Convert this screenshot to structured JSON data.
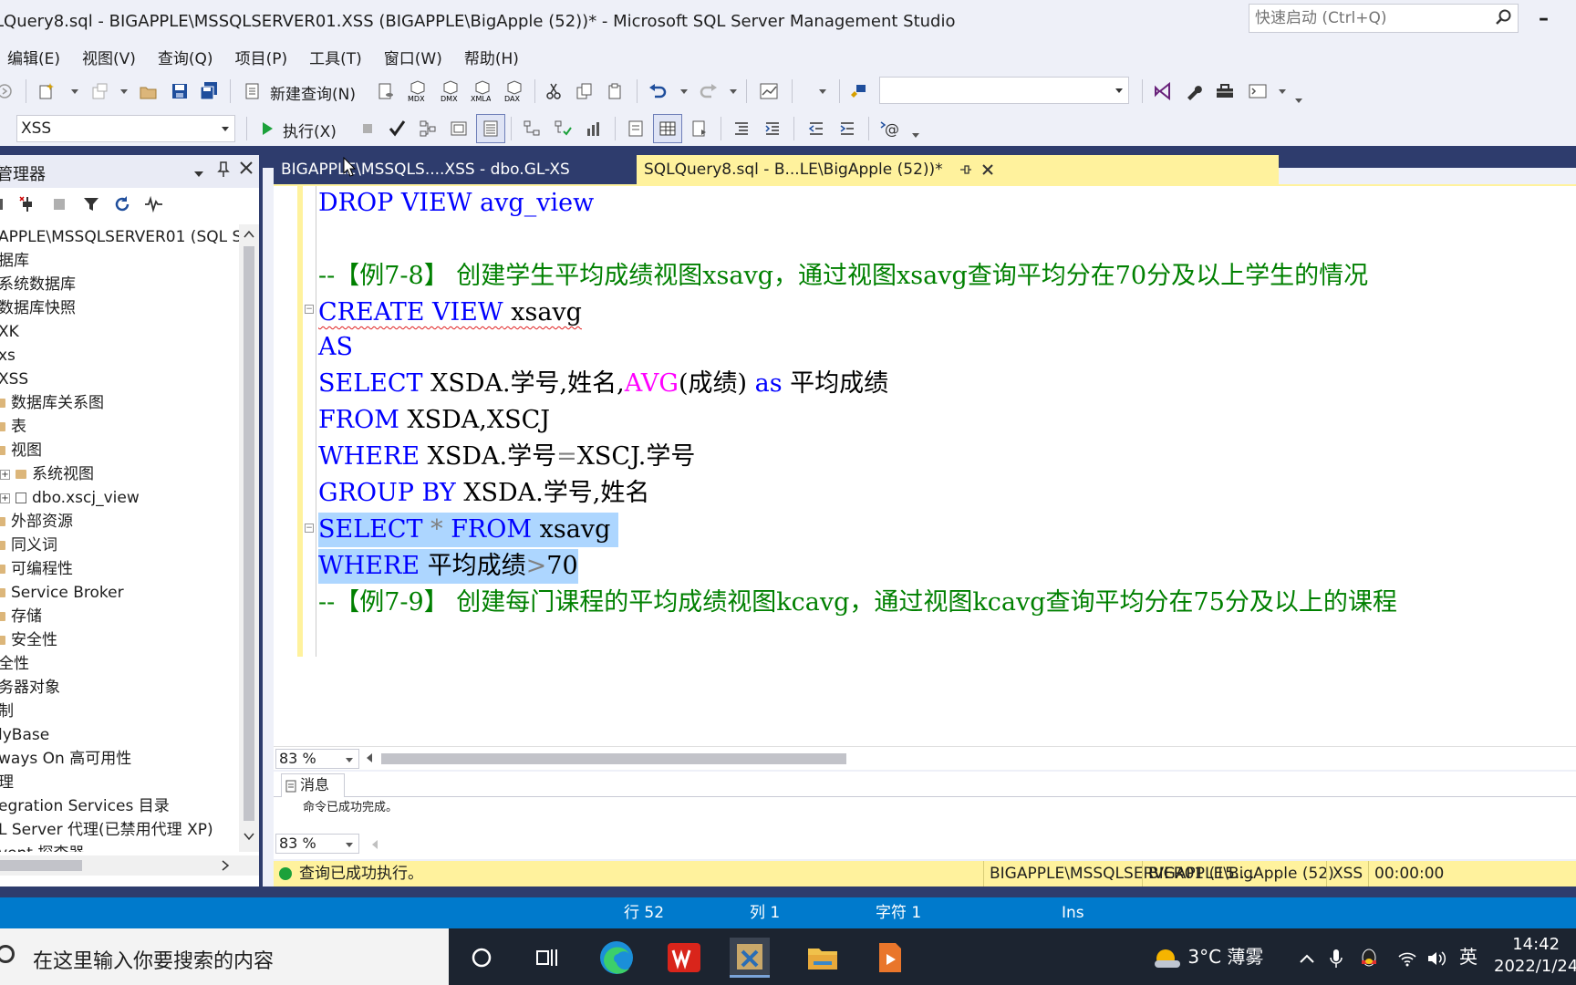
{
  "window": {
    "title": "LQuery8.sql - BIGAPPLE\\MSSQLSERVER01.XSS (BIGAPPLE\\BigApple (52))* - Microsoft SQL Server Management Studio",
    "quick_launch_placeholder": "快速启动 (Ctrl+Q)"
  },
  "menu": [
    "编辑(E)",
    "视图(V)",
    "查询(Q)",
    "项目(P)",
    "工具(T)",
    "窗口(W)",
    "帮助(H)"
  ],
  "toolbar": {
    "new_query": "新建查询(N)",
    "execute": "执行(X)",
    "database": "XSS",
    "mini_icons": [
      "MDX",
      "DMX",
      "XMLA",
      "DAX"
    ]
  },
  "object_explorer": {
    "title": "管理器",
    "server": "APPLE\\MSSQLSERVER01 (SQL Se",
    "items": [
      "据库",
      "系统数据库",
      "数据库快照",
      "XK",
      "xs",
      "XSS",
      "数据库关系图",
      "表",
      "视图",
      "系统视图",
      "dbo.xscj_view",
      "外部资源",
      "同义词",
      "可编程性",
      "Service Broker",
      "存储",
      "安全性",
      "全性",
      "务器对象",
      "制",
      "lyBase",
      "ways On 高可用性",
      "理",
      "egration Services 目录",
      "L Server 代理(已禁用代理 XP)",
      "vent 探查器"
    ]
  },
  "tabs": {
    "inactive": "BIGAPPLE\\MSSQLS....XSS - dbo.GL-XS",
    "active": "SQLQuery8.sql - B...LE\\BigApple (52))*"
  },
  "code": {
    "l1": "DROP VIEW avg_view",
    "l3": "--【例7-8】 创建学生平均成绩视图xsavg，通过视图xsavg查询平均分在70分及以上学生的情况",
    "l4a": "CREATE VIEW",
    "l4b": " xsavg",
    "l5": "AS",
    "l6a": "SELECT",
    "l6b": " XSDA.学号,姓名,",
    "l6c": "AVG",
    "l6d": "(成绩) ",
    "l6e": "as",
    "l6f": " 平均成绩",
    "l7a": "FROM",
    "l7b": " XSDA,XSCJ",
    "l8a": "WHERE",
    "l8b": " XSDA.学号",
    "l8c": "=",
    "l8d": "XSCJ.学号",
    "l9a": "GROUP BY",
    "l9b": " XSDA.学号,姓名",
    "l10a": "SELECT",
    "l10b": " * ",
    "l10c": "FROM",
    "l10d": " xsavg ",
    "l11a": "WHERE",
    "l11b": " 平均成绩",
    "l11c": ">",
    "l11d": "70",
    "l12": "--【例7-9】 创建每门课程的平均成绩视图kcavg，通过视图kcavg查询平均分在75分及以上的课程"
  },
  "zoom": "83 %",
  "results": {
    "tab_label": "消息",
    "message": "命令已成功完成。",
    "zoom": "83 %"
  },
  "query_status": {
    "message": "查询已成功执行。",
    "server": "BIGAPPLE\\MSSQLSERVER01 (15....",
    "user": "BIGAPPLE\\BigApple (52)",
    "db": "XSS",
    "time": "00:00:00"
  },
  "status": {
    "row": "行 52",
    "col": "列 1",
    "char": "字符 1",
    "mode": "Ins"
  },
  "taskbar": {
    "search_placeholder": "在这里输入你要搜索的内容",
    "weather": "3°C  薄雾",
    "ime": "英",
    "time": "14:42",
    "date": "2022/1/24"
  },
  "colors": {
    "keyword": "#0000ff",
    "comment": "#008000",
    "function": "#ff00ff",
    "selection": "#add6ff",
    "tab_active": "#fff29d",
    "frame": "#2e3c6d",
    "statusbar": "#007acc"
  }
}
